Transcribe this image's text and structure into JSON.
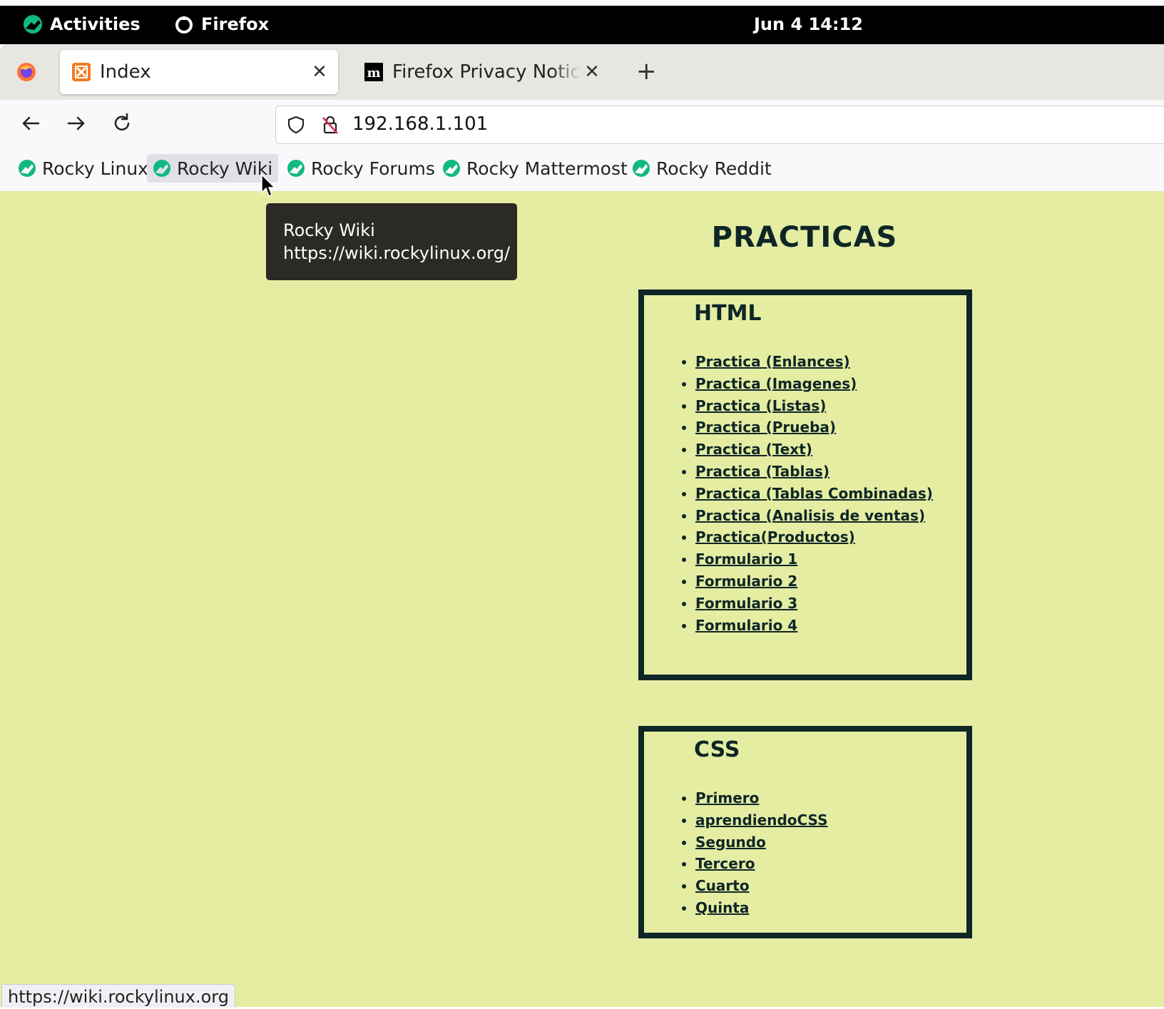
{
  "topbar": {
    "activities_label": "Activities",
    "app_label": "Firefox",
    "clock": "Jun 4  14:12"
  },
  "tabs": [
    {
      "title": "Index",
      "active": true
    },
    {
      "title": "Firefox Privacy Notice — M",
      "active": false
    }
  ],
  "navbar": {
    "url": "192.168.1.101"
  },
  "bookmarks": [
    {
      "label": "Rocky Linux"
    },
    {
      "label": "Rocky Wiki"
    },
    {
      "label": "Rocky Forums"
    },
    {
      "label": "Rocky Mattermost"
    },
    {
      "label": "Rocky Reddit"
    }
  ],
  "tooltip": {
    "title": "Rocky Wiki",
    "url": "https://wiki.rockylinux.org/"
  },
  "page": {
    "title": "PRACTICAS",
    "html_section": {
      "heading": "HTML",
      "links": [
        "Practica (Enlances)",
        "Practica (Imagenes)",
        "Practica (Listas)",
        "Practica (Prueba)",
        "Practica (Text)",
        "Practica (Tablas)",
        "Practica (Tablas Combinadas)",
        "Practica (Analisis de ventas)",
        "Practica(Productos)",
        "Formulario 1",
        "Formulario 2",
        "Formulario 3",
        "Formulario 4"
      ]
    },
    "css_section": {
      "heading": "CSS",
      "links": [
        "Primero",
        "aprendiendoCSS",
        "Segundo",
        "Tercero",
        "Cuarto",
        "Quinta"
      ]
    }
  },
  "statusbar": {
    "text": "https://wiki.rockylinux.org"
  },
  "colors": {
    "page_background": "#e5eda3",
    "box_border": "#0f2626",
    "rocky_green": "#10b981"
  }
}
